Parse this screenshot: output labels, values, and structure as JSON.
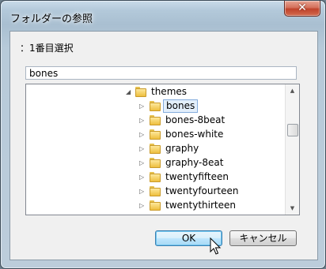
{
  "window": {
    "title": "フォルダーの参照",
    "close_glyph": "✕"
  },
  "description": "：1番目選択",
  "folder_field": {
    "value": "bones"
  },
  "tree": {
    "parent": {
      "label": "themes",
      "expanded": true
    },
    "children": [
      {
        "label": "bones",
        "selected": true
      },
      {
        "label": "bones-8beat",
        "selected": false
      },
      {
        "label": "bones-white",
        "selected": false
      },
      {
        "label": "graphy",
        "selected": false
      },
      {
        "label": "graphy-8eat",
        "selected": false
      },
      {
        "label": "twentyfifteen",
        "selected": false
      },
      {
        "label": "twentyfourteen",
        "selected": false
      },
      {
        "label": "twentythirteen",
        "selected": false
      }
    ],
    "scroll": {
      "up_icon": "scroll-up-arrow",
      "down_icon": "scroll-down-arrow"
    }
  },
  "buttons": {
    "ok": "OK",
    "cancel": "キャンセル"
  },
  "colors": {
    "selection_bg": "#e3effb",
    "selection_border": "#84acdd",
    "ok_border": "#3c7fb1"
  }
}
